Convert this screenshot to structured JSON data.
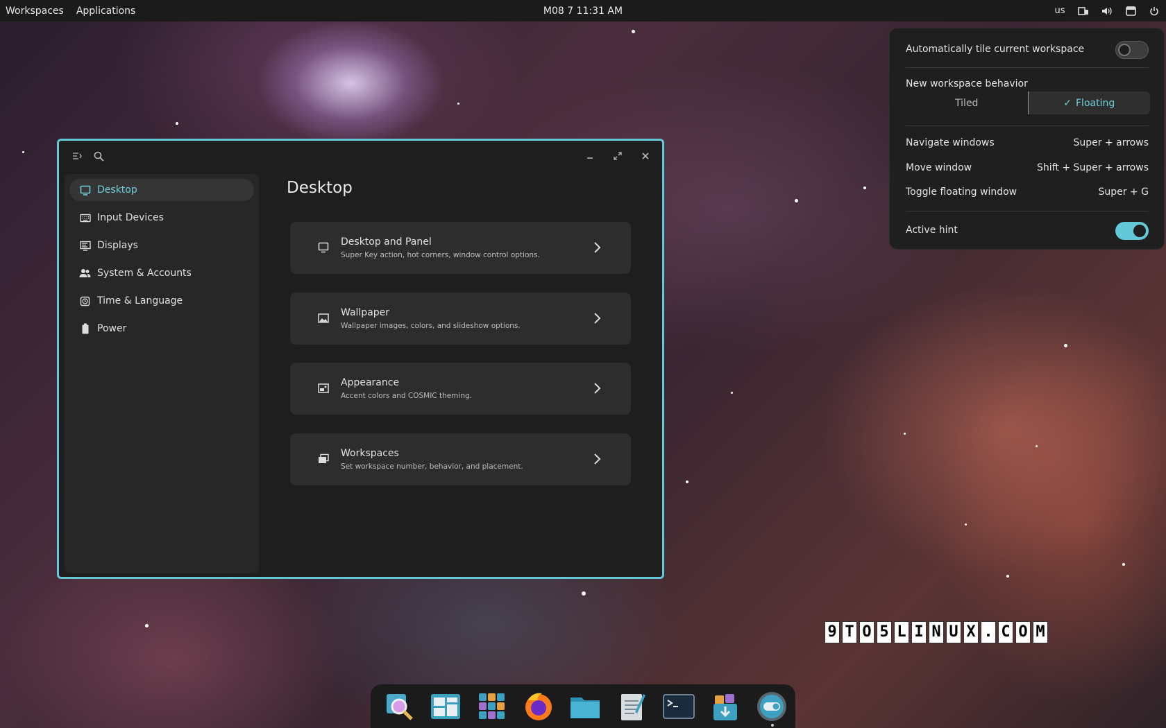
{
  "top_panel": {
    "workspaces": "Workspaces",
    "applications": "Applications",
    "clock": "M08 7 11:31 AM",
    "keyboard_layout": "us"
  },
  "settings_window": {
    "sidebar": [
      {
        "label": "Desktop",
        "icon": "monitor-icon",
        "active": true
      },
      {
        "label": "Input Devices",
        "icon": "keyboard-icon"
      },
      {
        "label": "Displays",
        "icon": "display-icon"
      },
      {
        "label": "System & Accounts",
        "icon": "users-icon"
      },
      {
        "label": "Time & Language",
        "icon": "clock-icon"
      },
      {
        "label": "Power",
        "icon": "battery-icon"
      }
    ],
    "page_title": "Desktop",
    "cards": [
      {
        "title": "Desktop and Panel",
        "desc": "Super Key action, hot corners, window control options.",
        "icon": "monitor-icon"
      },
      {
        "title": "Wallpaper",
        "desc": "Wallpaper images, colors, and slideshow options.",
        "icon": "image-icon"
      },
      {
        "title": "Appearance",
        "desc": "Accent colors and COSMIC theming.",
        "icon": "appearance-icon"
      },
      {
        "title": "Workspaces",
        "desc": "Set workspace number, behavior, and placement.",
        "icon": "workspaces-icon"
      }
    ]
  },
  "tiling_popup": {
    "auto_tile_label": "Automatically tile current workspace",
    "auto_tile_on": false,
    "new_ws_label": "New workspace behavior",
    "options": [
      "Tiled",
      "Floating"
    ],
    "selected": "Floating",
    "check": "✓",
    "shortcuts": [
      {
        "label": "Navigate windows",
        "keys": "Super + arrows"
      },
      {
        "label": "Move window",
        "keys": "Shift + Super + arrows"
      },
      {
        "label": "Toggle floating window",
        "keys": "Super + G"
      }
    ],
    "active_hint_label": "Active hint",
    "active_hint_on": true
  },
  "dock": {
    "items": [
      "search-app-icon",
      "workspaces-app-icon",
      "app-library-icon",
      "firefox-icon",
      "files-icon",
      "text-editor-icon",
      "terminal-icon",
      "store-icon",
      "settings-app-icon"
    ]
  },
  "watermark": [
    "9",
    "T",
    "O",
    "5",
    "L",
    "I",
    "N",
    "U",
    "X",
    ".",
    "C",
    "O",
    "M"
  ],
  "colors": {
    "accent": "#63c8d8",
    "panel": "#1b1b1b",
    "window": "#1e1e1e"
  }
}
